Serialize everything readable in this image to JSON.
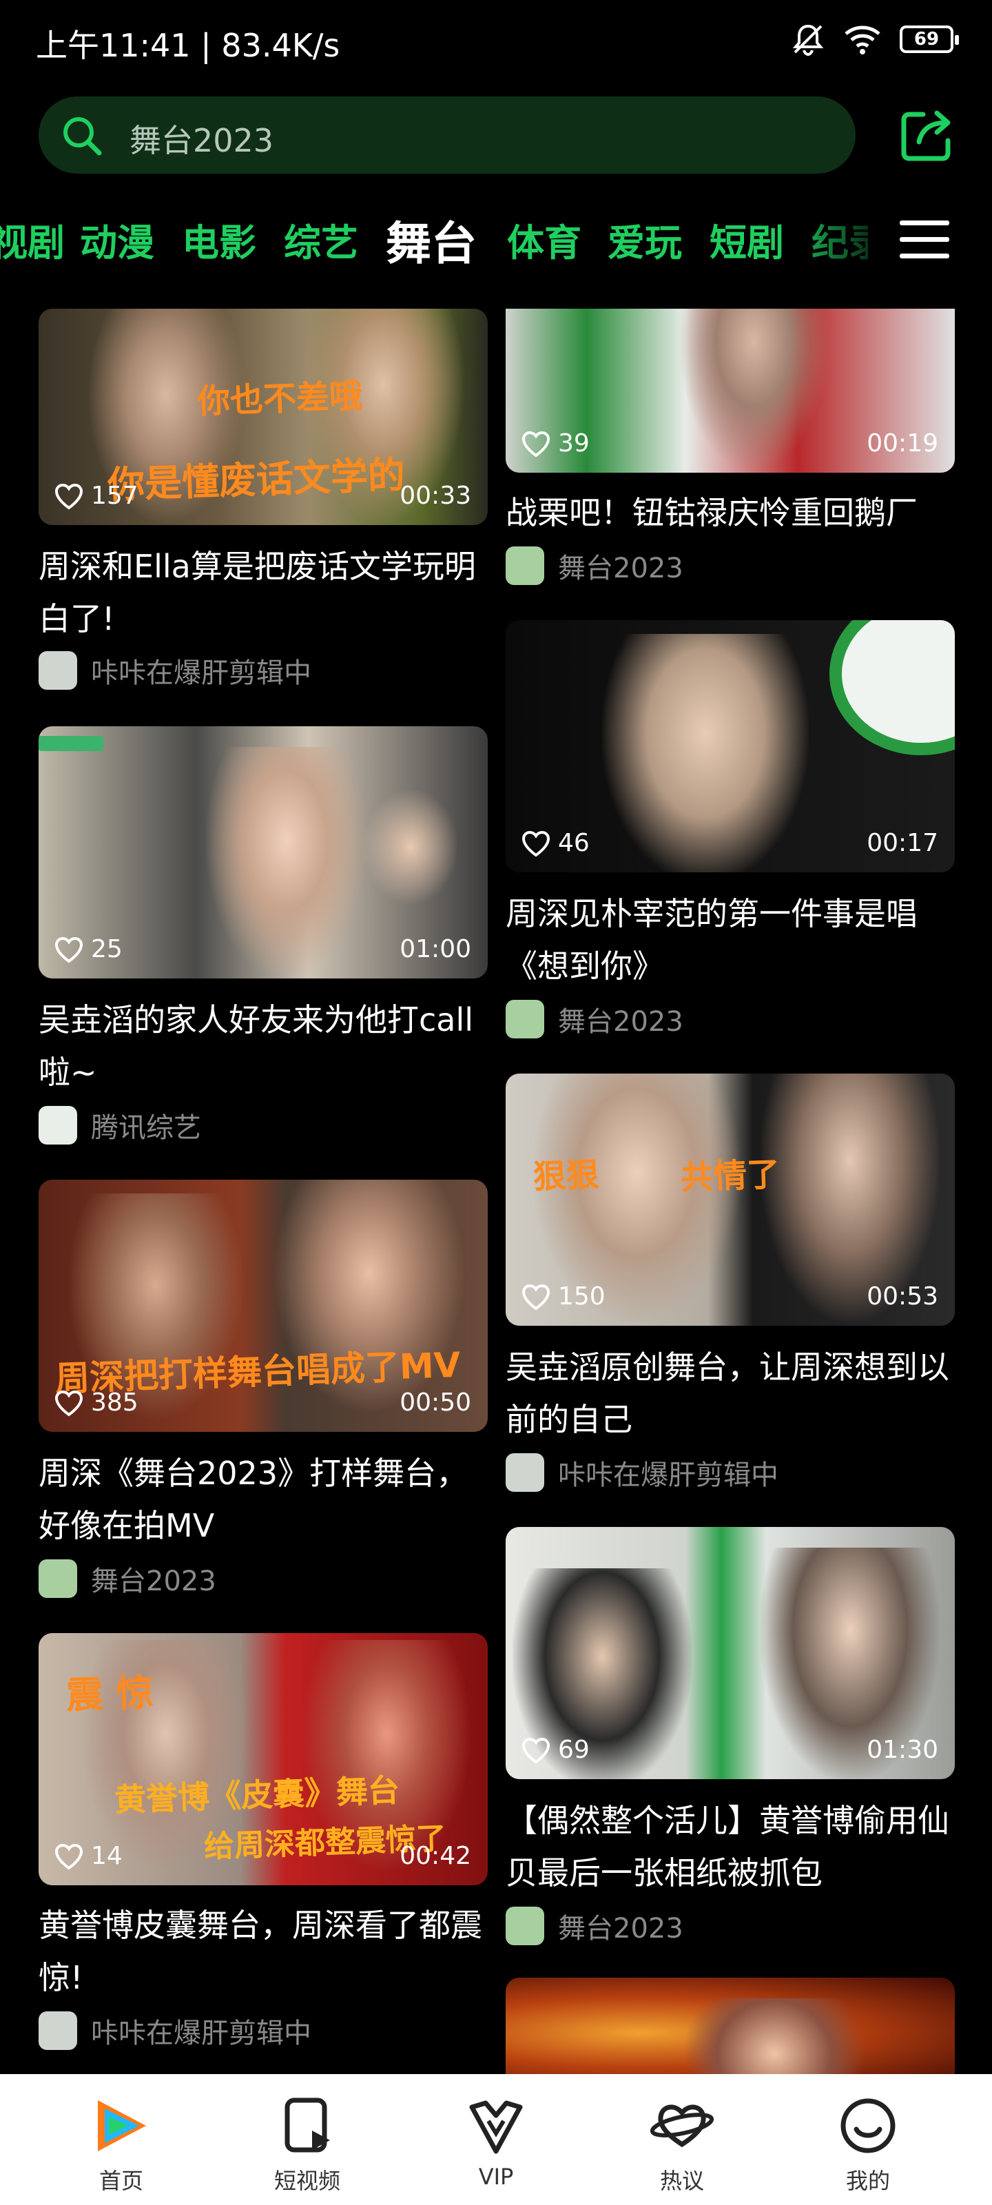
{
  "status_bar": {
    "time": "上午11:41 | 83.4K/s",
    "battery": "69"
  },
  "search": {
    "query": "舞台2023"
  },
  "tabs": [
    {
      "label": "视剧"
    },
    {
      "label": "动漫"
    },
    {
      "label": "电影"
    },
    {
      "label": "综艺"
    },
    {
      "label": "舞台"
    },
    {
      "label": "体育"
    },
    {
      "label": "爱玩"
    },
    {
      "label": "短剧"
    },
    {
      "label": "纪录"
    }
  ],
  "left_feed": [
    {
      "likes": "157",
      "duration": "00:33",
      "caption_1": "你也不差哦",
      "caption_2": "你是懂废话文学的",
      "title": "周深和Ella算是把废话文学玩明白了!",
      "author": "咔咔在爆肝剪辑中"
    },
    {
      "likes": "25",
      "duration": "01:00",
      "caption_1": "",
      "caption_2": "",
      "title": "吴垚滔的家人好友来为他打call啦~",
      "author": "腾讯综艺"
    },
    {
      "likes": "385",
      "duration": "00:50",
      "caption_1": "",
      "caption_2": "周深把打样舞台唱成了MV",
      "title": "周深《舞台2023》打样舞台，好像在拍MV",
      "author": "舞台2023"
    },
    {
      "likes": "14",
      "duration": "00:42",
      "caption_1": "震 惊",
      "caption_2": "黄誉博《皮囊》舞台",
      "caption_3": "给周深都整震惊了",
      "title": "黄誉博皮囊舞台，周深看了都震惊!",
      "author": "咔咔在爆肝剪辑中"
    }
  ],
  "right_feed": [
    {
      "likes": "39",
      "duration": "00:19",
      "title": "战栗吧！钮钴禄庆怜重回鹅厂",
      "author": "舞台2023"
    },
    {
      "likes": "46",
      "duration": "00:17",
      "title": "周深见朴宰范的第一件事是唱《想到你》",
      "author": "舞台2023"
    },
    {
      "likes": "150",
      "duration": "00:53",
      "caption_1": "狠狠",
      "caption_2": "共情了",
      "title": "吴垚滔原创舞台，让周深想到以前的自己",
      "author": "咔咔在爆肝剪辑中"
    },
    {
      "likes": "69",
      "duration": "01:30",
      "title": "【偶然整个活儿】黄誉博偷用仙贝最后一张相纸被抓包",
      "author": "舞台2023"
    }
  ],
  "bottom_nav": [
    {
      "label": "首页"
    },
    {
      "label": "短视频"
    },
    {
      "label": "VIP"
    },
    {
      "label": "热议"
    },
    {
      "label": "我的"
    }
  ],
  "colors": {
    "accent": "#1fcf60",
    "search_bg": "#0e2f16",
    "caption_orange": "#ff8a1e"
  }
}
